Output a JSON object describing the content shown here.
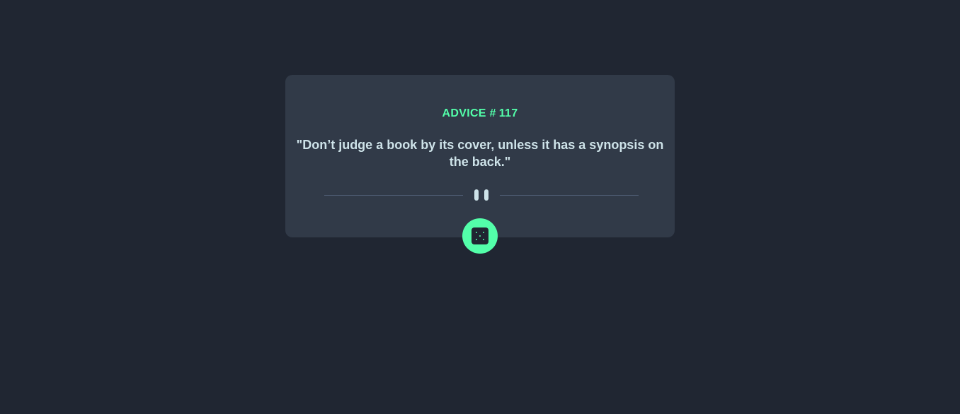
{
  "card": {
    "label": "ADVICE #",
    "id": "117",
    "quote": "\"Don’t judge a book by its cover, unless it has a synopsis on the back.\""
  },
  "icons": {
    "divider_icon": "pause-icon",
    "button_icon": "dice-icon"
  },
  "colors": {
    "background": "#202632",
    "card": "#313a48",
    "accent": "#53ffaa",
    "text": "#cee3e9"
  }
}
